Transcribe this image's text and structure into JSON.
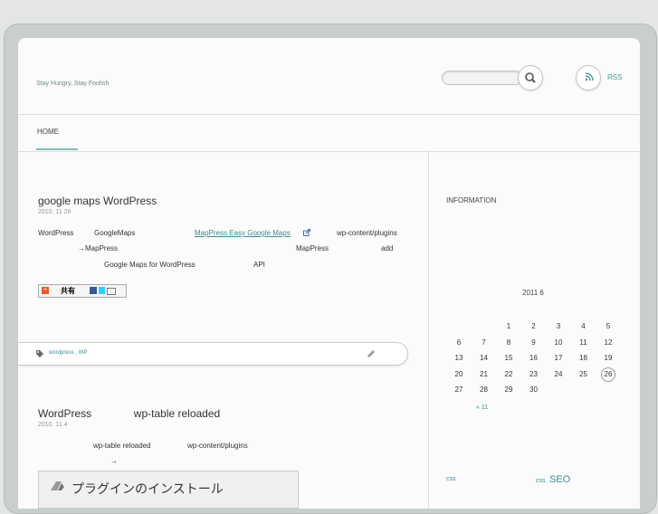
{
  "header": {
    "tagline": "Stay Hungry, Stay Foolish",
    "rss_label": "RSS"
  },
  "nav": {
    "items": [
      "HOME"
    ]
  },
  "posts": [
    {
      "title": "google maps WordPress",
      "date": "2010. 11 26",
      "lines": [
        [
          "WordPress",
          "GoogleMaps",
          "MapPress Easy Google Maps",
          "wp-content/plugins"
        ],
        [
          "→MapPress",
          "MapPress",
          "add"
        ],
        [
          "Google Maps for WordPress",
          "API"
        ]
      ],
      "share_label": "共有",
      "tags": "wordpress , WP"
    },
    {
      "title": "WordPress              wp-table reloaded",
      "date": "2010. 11 4",
      "line1": [
        "wp-table reloaded",
        "wp-content/plugins"
      ],
      "line2": "→",
      "image_text": "プラグインのインストール"
    }
  ],
  "sidebar": {
    "heading": "INFORMATION",
    "calendar": {
      "title": "2011 6",
      "weeks": [
        [
          "",
          "",
          "1",
          "2",
          "3",
          "4",
          "5"
        ],
        [
          "6",
          "7",
          "8",
          "9",
          "10",
          "11",
          "12"
        ],
        [
          "13",
          "14",
          "15",
          "16",
          "17",
          "18",
          "19"
        ],
        [
          "20",
          "21",
          "22",
          "23",
          "24",
          "25",
          "26"
        ],
        [
          "27",
          "28",
          "29",
          "30",
          "",
          "",
          ""
        ]
      ],
      "today": "26",
      "prev_link": "« 11"
    },
    "tag_cloud": [
      "css",
      "css",
      "SEO"
    ]
  }
}
